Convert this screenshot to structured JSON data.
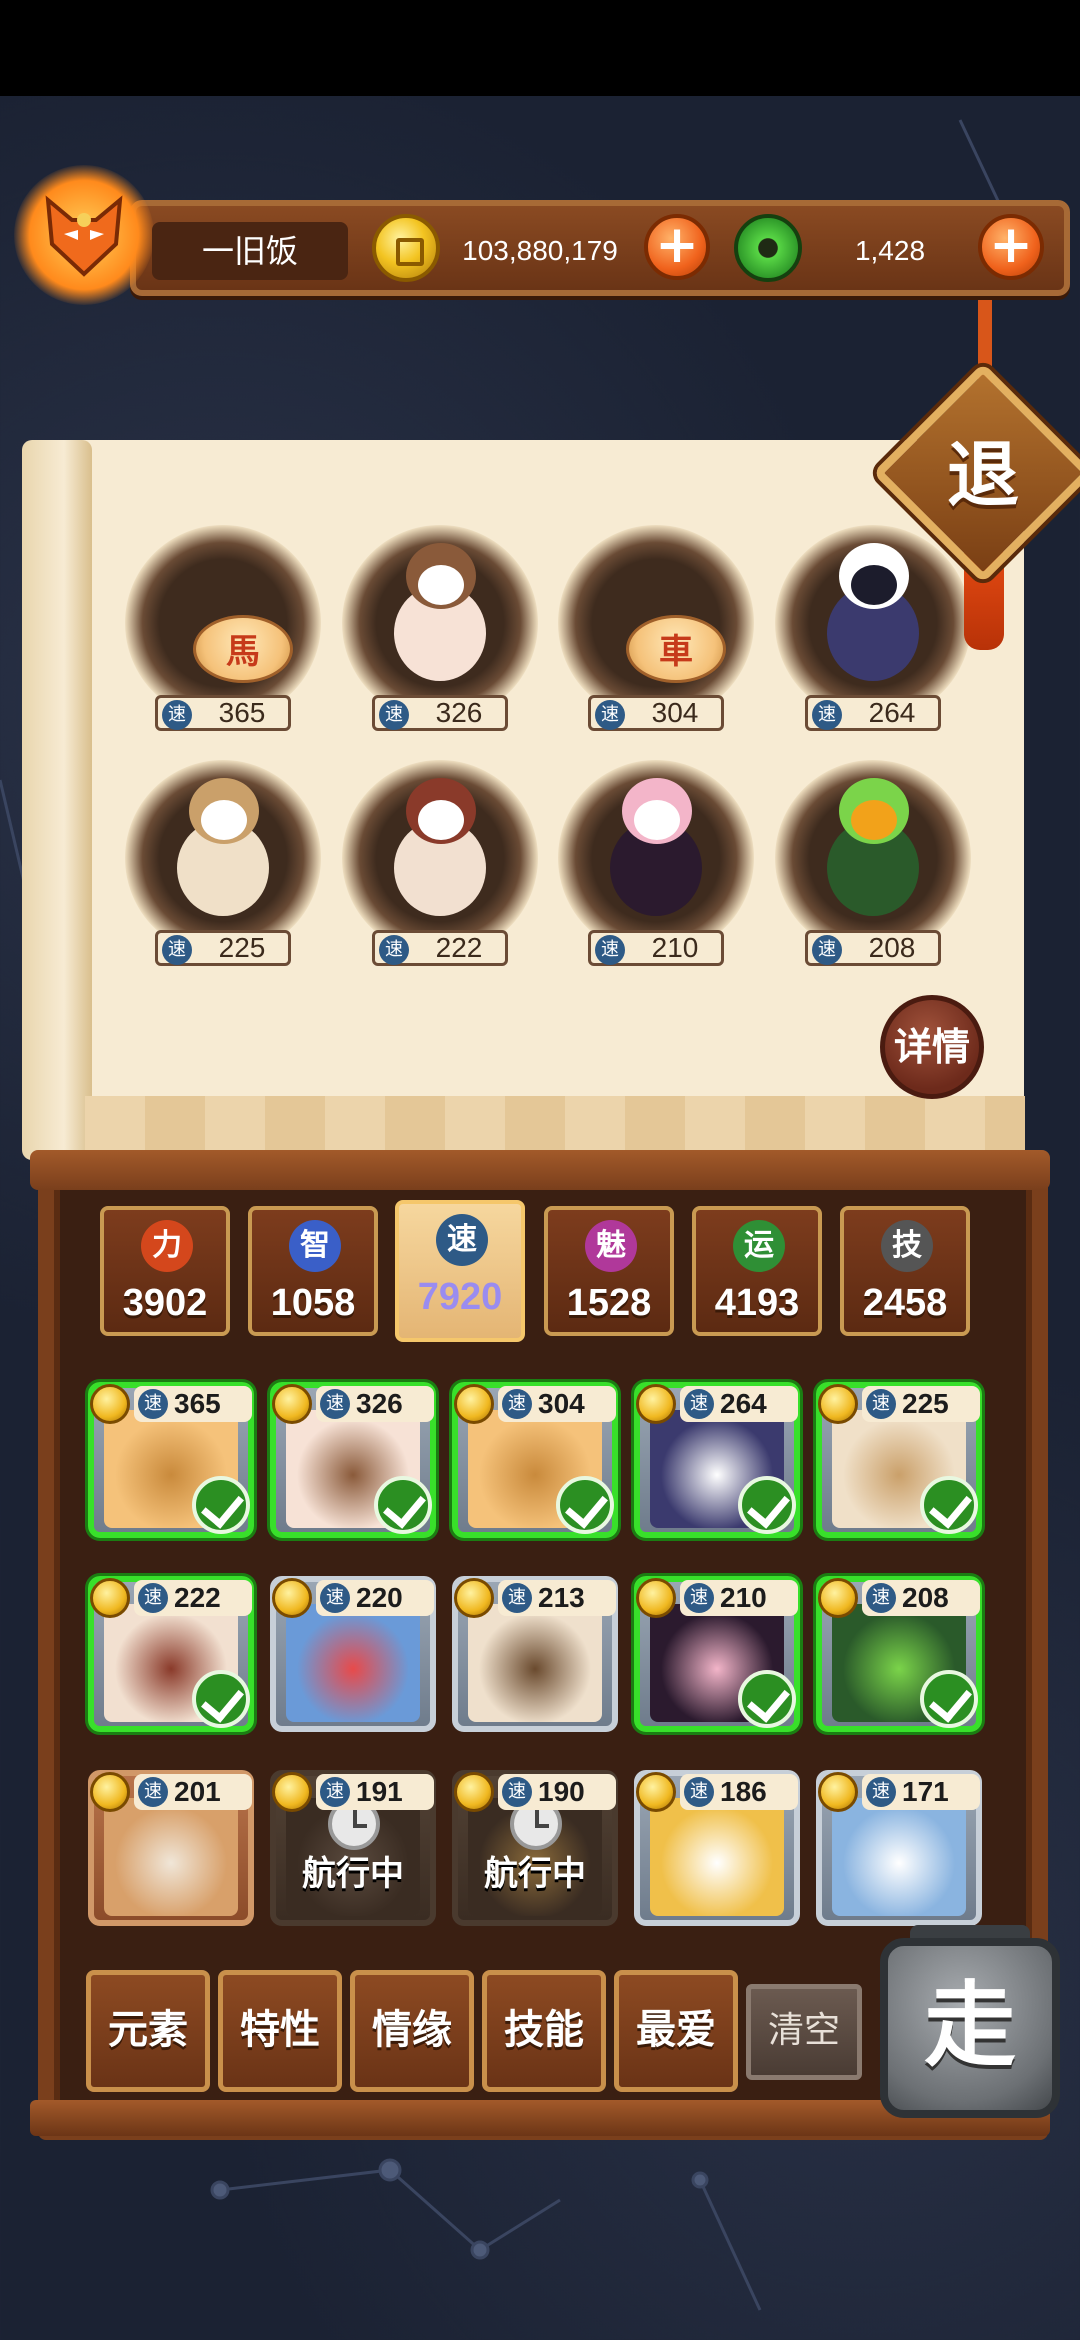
{
  "player": {
    "name": "一旧饭",
    "coins": "103,880,179",
    "jade": "1,428"
  },
  "icons": {
    "avatar": "fox-mask-icon",
    "coin": "gold-coin-icon",
    "jade": "jade-ring-icon",
    "add": "plus-icon",
    "check": "check-icon",
    "clock": "clock-icon"
  },
  "exit_label": "退",
  "detail_label": "详情",
  "speed_char": "速",
  "lineup": [
    {
      "speed": "365",
      "piece": "馬"
    },
    {
      "speed": "326",
      "piece": ""
    },
    {
      "speed": "304",
      "piece": "車"
    },
    {
      "speed": "264",
      "piece": ""
    },
    {
      "speed": "225",
      "piece": ""
    },
    {
      "speed": "222",
      "piece": ""
    },
    {
      "speed": "210",
      "piece": ""
    },
    {
      "speed": "208",
      "piece": ""
    }
  ],
  "stats": [
    {
      "icon": "力",
      "value": "3902",
      "color": "#d4471c"
    },
    {
      "icon": "智",
      "value": "1058",
      "color": "#3a5fc8"
    },
    {
      "icon": "速",
      "value": "7920",
      "color": "#2e5a86"
    },
    {
      "icon": "魅",
      "value": "1528",
      "color": "#b0389a"
    },
    {
      "icon": "运",
      "value": "4193",
      "color": "#2f8f35"
    },
    {
      "icon": "技",
      "value": "2458",
      "color": "#555555"
    }
  ],
  "active_stat": "速",
  "roster": [
    {
      "speed": "365",
      "selected": true
    },
    {
      "speed": "326",
      "selected": true
    },
    {
      "speed": "304",
      "selected": true
    },
    {
      "speed": "264",
      "selected": true
    },
    {
      "speed": "225",
      "selected": true
    },
    {
      "speed": "222",
      "selected": true
    },
    {
      "speed": "220",
      "selected": false
    },
    {
      "speed": "213",
      "selected": false
    },
    {
      "speed": "210",
      "selected": true
    },
    {
      "speed": "208",
      "selected": true
    },
    {
      "speed": "201",
      "selected": false
    },
    {
      "speed": "191",
      "selected": false,
      "status": "航行中"
    },
    {
      "speed": "190",
      "selected": false,
      "status": "航行中"
    },
    {
      "speed": "186",
      "selected": false
    },
    {
      "speed": "171",
      "selected": false
    }
  ],
  "filters": [
    "元素",
    "特性",
    "情缘",
    "技能",
    "最爱"
  ],
  "clear_label": "清空",
  "go_label": "走"
}
